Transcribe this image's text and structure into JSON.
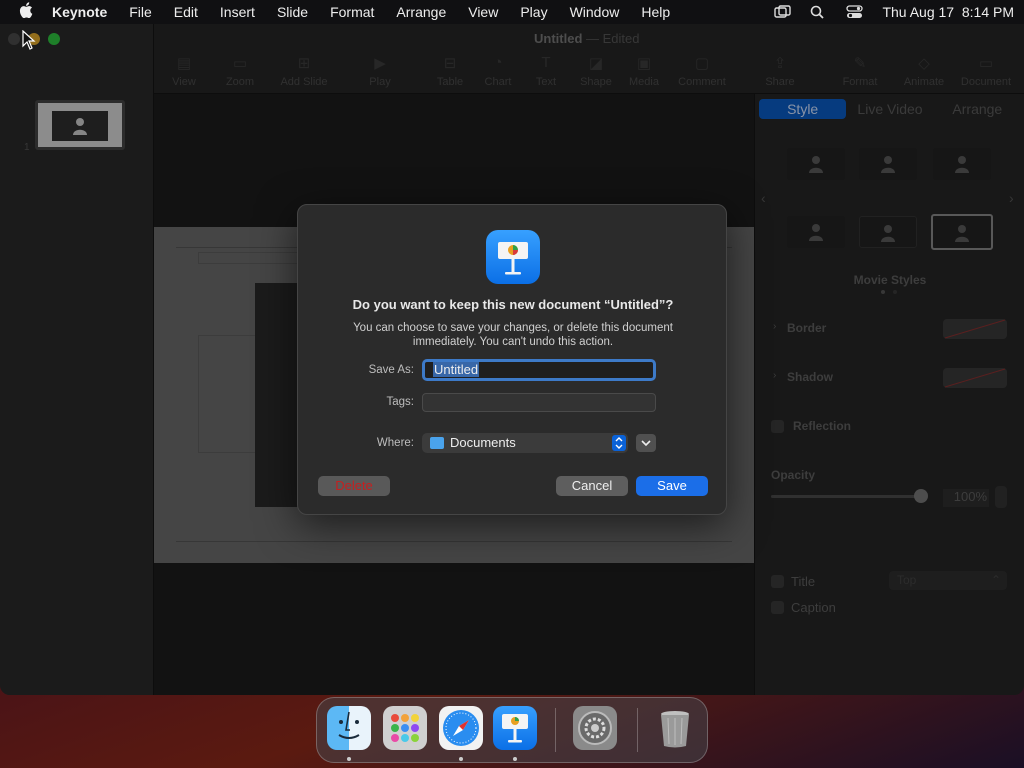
{
  "menubar": {
    "app_name": "Keynote",
    "items": [
      "File",
      "Edit",
      "Insert",
      "Slide",
      "Format",
      "Arrange",
      "View",
      "Play",
      "Window",
      "Help"
    ],
    "clock": "Thu Aug 17  8:14 PM"
  },
  "window": {
    "title": "Untitled",
    "title_suffix": "— Edited",
    "toolbar": [
      "View",
      "Zoom",
      "Add Slide",
      "Play",
      "Table",
      "Chart",
      "Text",
      "Shape",
      "Media",
      "Comment",
      "Share",
      "Format",
      "Animate",
      "Document"
    ],
    "slide_number": "1"
  },
  "inspector": {
    "tabs": [
      "Style",
      "Live Video",
      "Arrange"
    ],
    "movie_styles_label": "Movie Styles",
    "border_label": "Border",
    "shadow_label": "Shadow",
    "reflection_label": "Reflection",
    "opacity_label": "Opacity",
    "opacity_value": "100%",
    "opacity_level": 1.0,
    "title_label": "Title",
    "title_position": "Top",
    "caption_label": "Caption"
  },
  "dialog": {
    "title": "Do you want to keep this new document “Untitled”?",
    "message": "You can choose to save your changes, or delete this document immediately. You can't undo this action.",
    "save_as_label": "Save As:",
    "save_as_value": "Untitled",
    "tags_label": "Tags:",
    "tags_value": "",
    "where_label": "Where:",
    "where_value": "Documents",
    "delete_label": "Delete",
    "cancel_label": "Cancel",
    "save_label": "Save"
  },
  "dock": {
    "apps": [
      "Finder",
      "Launchpad",
      "Safari",
      "Keynote",
      "System Settings",
      "Trash"
    ]
  },
  "colors": {
    "accent": "#1b6ee8",
    "delete_text": "#c42020"
  }
}
